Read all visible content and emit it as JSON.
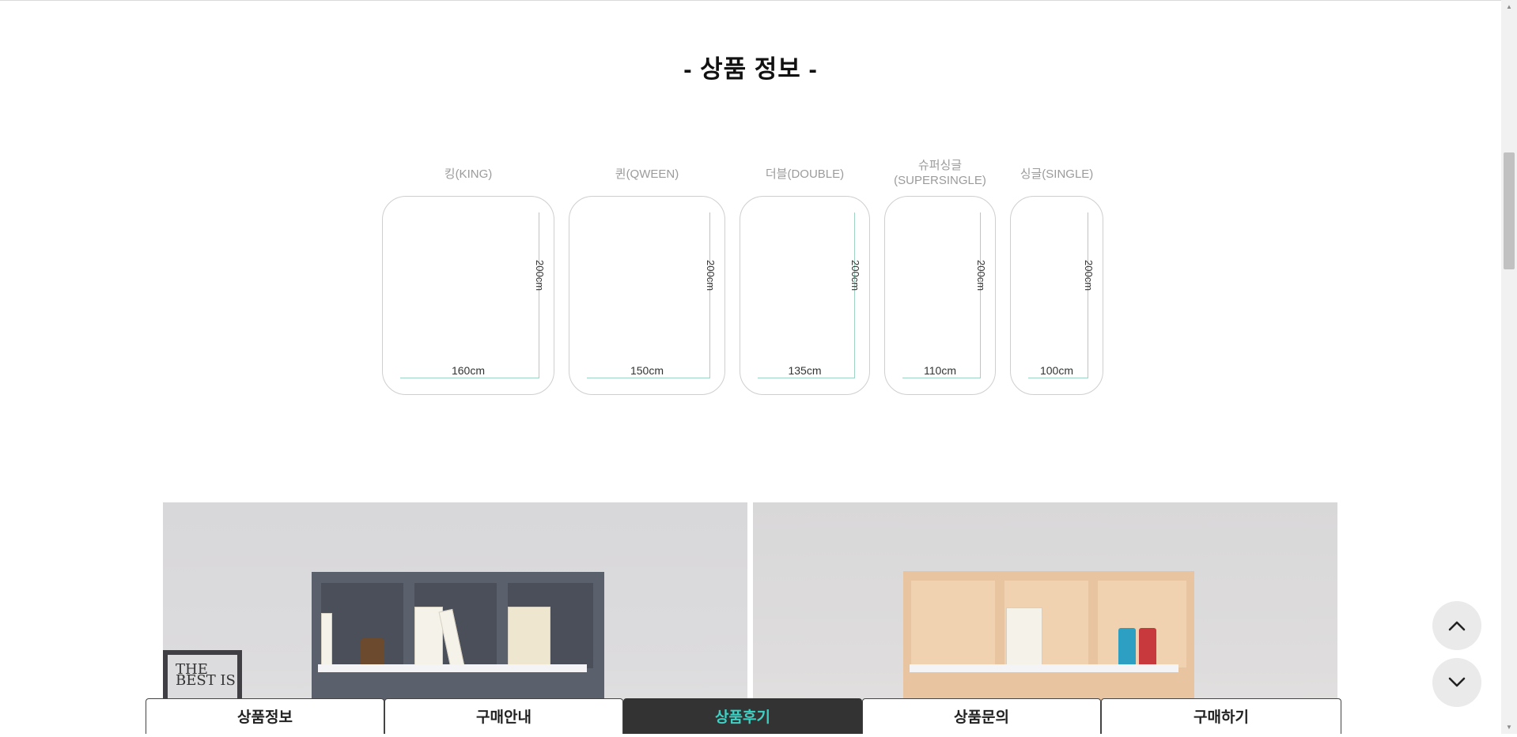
{
  "section": {
    "title": "- 상품 정보 -"
  },
  "sizes": [
    {
      "label": "킹(KING)",
      "length": "200cm",
      "width": "160cm"
    },
    {
      "label": "퀸(QWEEN)",
      "length": "200cm",
      "width": "150cm"
    },
    {
      "label": "더블(DOUBLE)",
      "length": "200cm",
      "width": "135cm"
    },
    {
      "label_line1": "슈퍼싱글",
      "label_line2": "(SUPERSINGLE)",
      "length": "200cm",
      "width": "110cm"
    },
    {
      "label": "싱글(SINGLE)",
      "length": "200cm",
      "width": "100cm"
    }
  ],
  "photo_left": {
    "frame_text": "THE BEST IS"
  },
  "tabs": [
    {
      "label": "상품정보",
      "active": false
    },
    {
      "label": "구매안내",
      "active": false
    },
    {
      "label": "상품후기",
      "active": true
    },
    {
      "label": "상품문의",
      "active": false
    },
    {
      "label": "구매하기",
      "active": false
    }
  ],
  "colors": {
    "active_tab_bg": "#333333",
    "active_tab_text": "#3fd0c4",
    "guide_line": "#9fd4c4"
  },
  "icons": {
    "scroll_top": "chevron-up-icon",
    "scroll_bottom": "chevron-down-icon"
  }
}
